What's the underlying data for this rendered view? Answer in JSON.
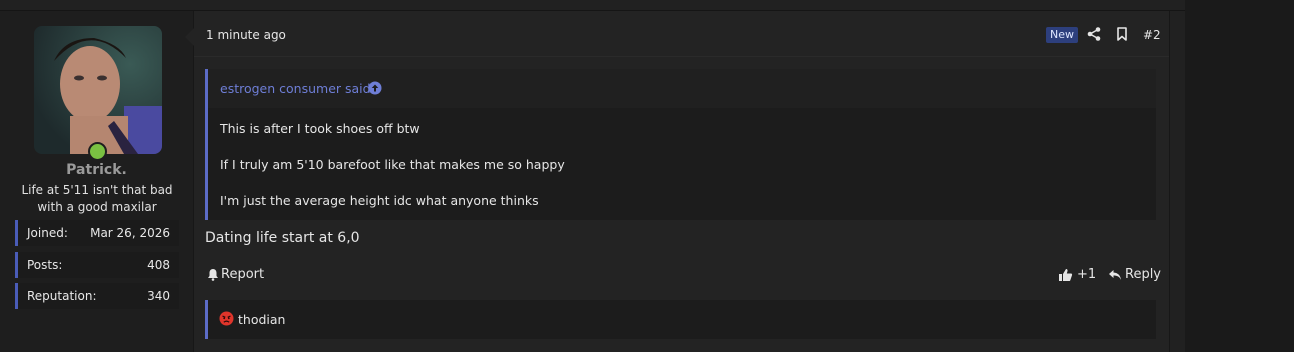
{
  "post": {
    "time": "1 minute ago",
    "badge": "New",
    "number": "#2",
    "body": "Dating life start at 6,0"
  },
  "user": {
    "name": "Patrick.",
    "title": "Life at 5'11 isn't that bad with a good maxilar",
    "stats": [
      {
        "label": "Joined:",
        "value": "Mar 26, 2026"
      },
      {
        "label": "Posts:",
        "value": "408"
      },
      {
        "label": "Reputation:",
        "value": "340"
      }
    ],
    "online": true
  },
  "quote": {
    "author": "estrogen consumer said:",
    "lines": [
      "This is after I took shoes off btw",
      "If I truly am 5'10 barefoot like that makes me so happy",
      "I'm just the average height idc what anyone thinks"
    ]
  },
  "actions": {
    "report": "Report",
    "like_count": "+1",
    "reply": "Reply"
  },
  "reactions": {
    "user": "thodian",
    "icon": "angry-face-icon"
  },
  "colors": {
    "accent": "#5c6cc7",
    "link": "#6e7ed6",
    "online": "#7ac142",
    "badge": "#2d3f7d"
  }
}
